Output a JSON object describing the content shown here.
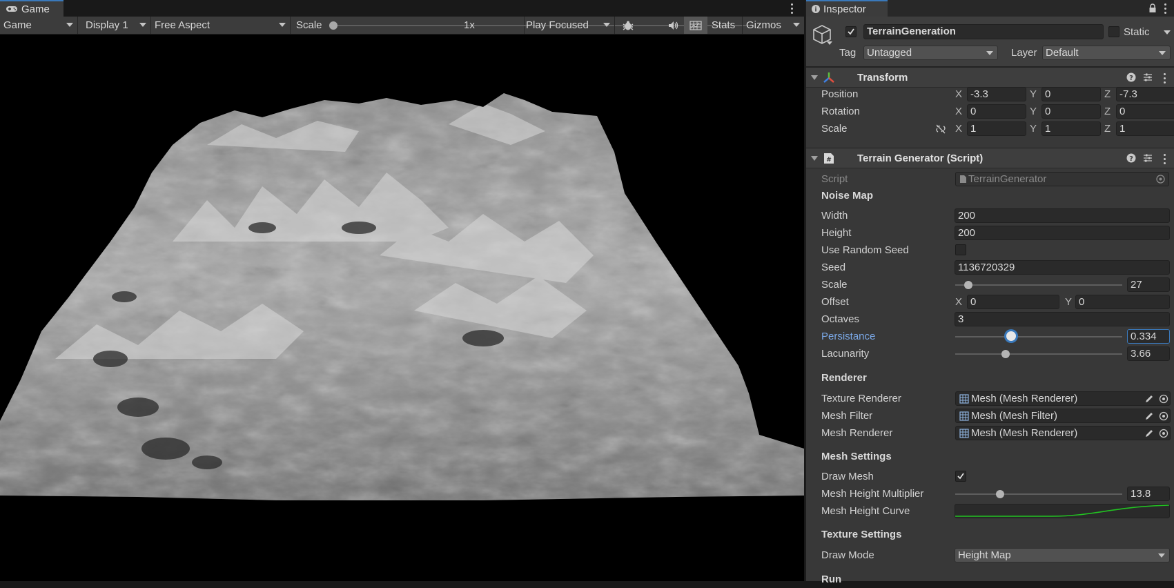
{
  "game": {
    "tab_label": "Game",
    "toolbar": {
      "view_mode": "Game",
      "display": "Display 1",
      "aspect": "Free Aspect",
      "scale_label": "Scale",
      "scale_value": "1x",
      "scale_fraction": 0.0,
      "play_mode": "Play Focused",
      "stats": "Stats",
      "gizmos": "Gizmos"
    }
  },
  "inspector": {
    "tab_label": "Inspector",
    "object": {
      "name": "TerrainGeneration",
      "active": true,
      "static_label": "Static",
      "tag_label": "Tag",
      "tag_value": "Untagged",
      "layer_label": "Layer",
      "layer_value": "Default"
    },
    "transform": {
      "title": "Transform",
      "rows": [
        {
          "label": "Position",
          "x": "-3.3",
          "y": "0",
          "z": "-7.3"
        },
        {
          "label": "Rotation",
          "x": "0",
          "y": "0",
          "z": "0"
        },
        {
          "label": "Scale",
          "x": "1",
          "y": "1",
          "z": "1"
        }
      ],
      "axis": {
        "x": "X",
        "y": "Y",
        "z": "Z"
      }
    },
    "terrain": {
      "title": "Terrain Generator (Script)",
      "script_label": "Script",
      "script_value": "TerrainGenerator",
      "noise_header": "Noise Map",
      "width_label": "Width",
      "width_value": "200",
      "height_label": "Height",
      "height_value": "200",
      "random_seed_label": "Use Random Seed",
      "random_seed_checked": false,
      "seed_label": "Seed",
      "seed_value": "1136720329",
      "scale_label": "Scale",
      "scale_value": "27",
      "scale_fraction": 0.08,
      "offset_label": "Offset",
      "offset_x": "0",
      "offset_y": "0",
      "octaves_label": "Octaves",
      "octaves_value": "3",
      "persistance_label": "Persistance",
      "persistance_value": "0.334",
      "persistance_fraction": 0.334,
      "lacunarity_label": "Lacunarity",
      "lacunarity_value": "3.66",
      "lacunarity_fraction": 0.3,
      "renderer_header": "Renderer",
      "texture_renderer_label": "Texture Renderer",
      "texture_renderer_value": "Mesh (Mesh Renderer)",
      "mesh_filter_label": "Mesh Filter",
      "mesh_filter_value": "Mesh (Mesh Filter)",
      "mesh_renderer_label": "Mesh Renderer",
      "mesh_renderer_value": "Mesh (Mesh Renderer)",
      "mesh_settings_header": "Mesh Settings",
      "draw_mesh_label": "Draw Mesh",
      "draw_mesh_checked": true,
      "height_mult_label": "Mesh Height Multiplier",
      "height_mult_value": "13.8",
      "height_mult_fraction": 0.27,
      "height_curve_label": "Mesh Height Curve",
      "texture_settings_header": "Texture Settings",
      "draw_mode_label": "Draw Mode",
      "draw_mode_value": "Height Map",
      "run_header": "Run"
    }
  },
  "colors": {
    "accent_blue": "#3a79bb",
    "curve_green": "#22c222",
    "persist_label": "#7ba9e8"
  }
}
